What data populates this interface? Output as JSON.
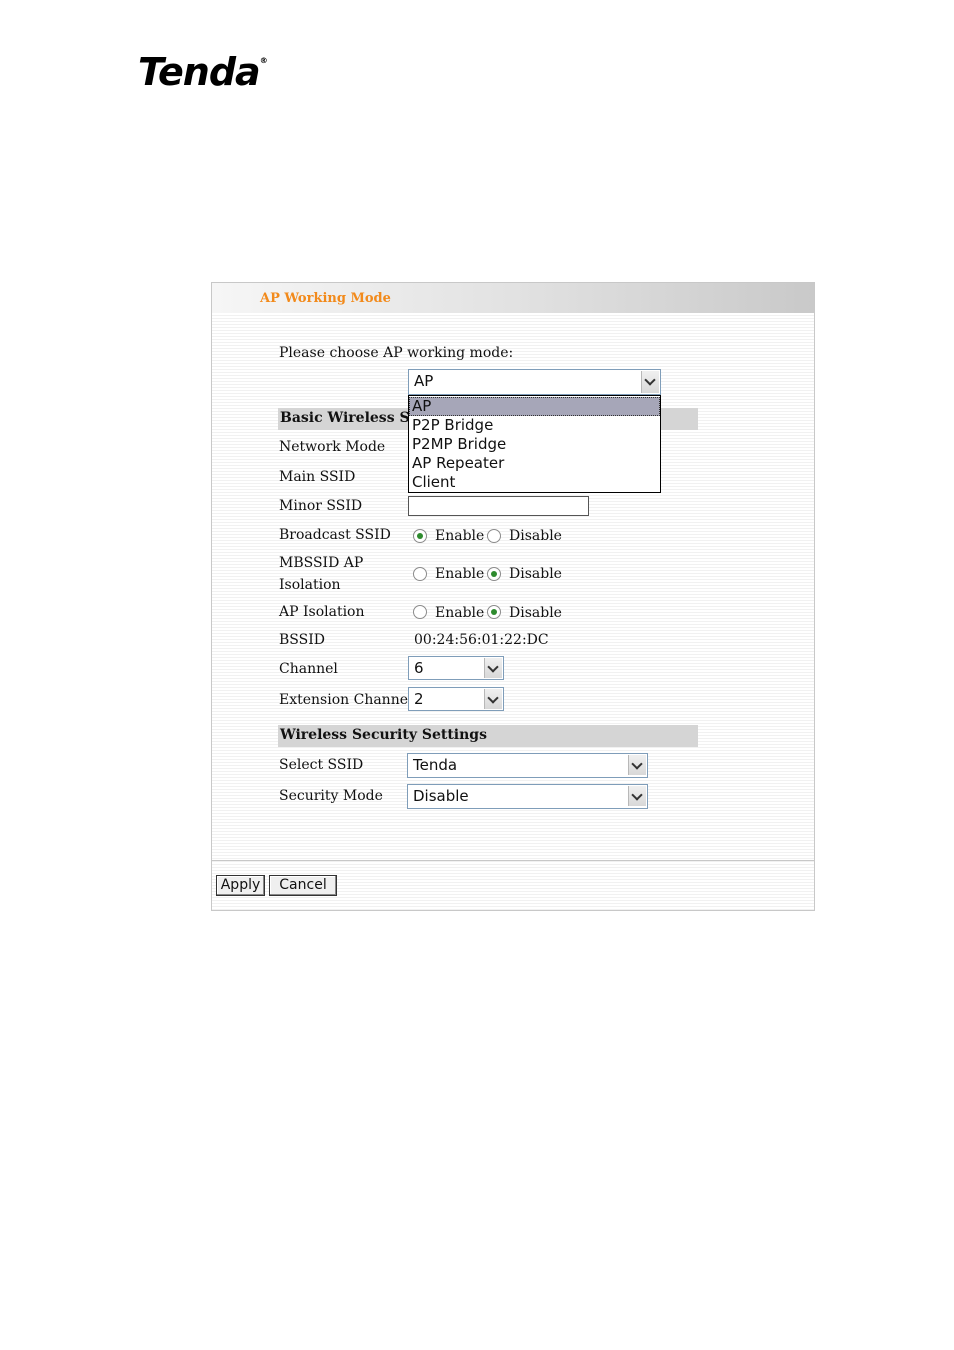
{
  "brand": {
    "logo_text": "Tenda",
    "trademark": "®"
  },
  "page": {
    "title": "AP Working Mode",
    "choose_label": "Please choose AP working mode:",
    "mode_select": {
      "value": "AP",
      "options": [
        "AP",
        "P2P Bridge",
        "P2MP Bridge",
        "AP Repeater",
        "Client"
      ],
      "selected_option": "AP"
    }
  },
  "basic": {
    "section_title": "Basic Wireless Setti",
    "network_mode_label": "Network Mode",
    "main_ssid_label": "Main SSID",
    "minor_ssid_label": "Minor SSID",
    "minor_ssid_value": "",
    "broadcast_ssid_label": "Broadcast SSID",
    "broadcast_ssid_value": "Enable",
    "mbssid_label_1": "MBSSID AP",
    "mbssid_label_2": "Isolation",
    "mbssid_value": "Disable",
    "ap_isolation_label": "AP Isolation",
    "ap_isolation_value": "Disable",
    "enable_label": "Enable",
    "disable_label": "Disable",
    "bssid_label": "BSSID",
    "bssid_value": "00:24:56:01:22:DC",
    "channel_label": "Channel",
    "channel_value": "6",
    "ext_channel_label": "Extension Channel",
    "ext_channel_value": "2"
  },
  "security": {
    "section_title": "Wireless Security Settings",
    "select_ssid_label": "Select SSID",
    "select_ssid_value": "Tenda",
    "security_mode_label": "Security Mode",
    "security_mode_value": "Disable"
  },
  "buttons": {
    "apply": "Apply",
    "cancel": "Cancel"
  },
  "colors": {
    "title_orange": "#f28a1b",
    "section_gray": "#d5d5d5",
    "radio_green": "#2e8b2e"
  }
}
